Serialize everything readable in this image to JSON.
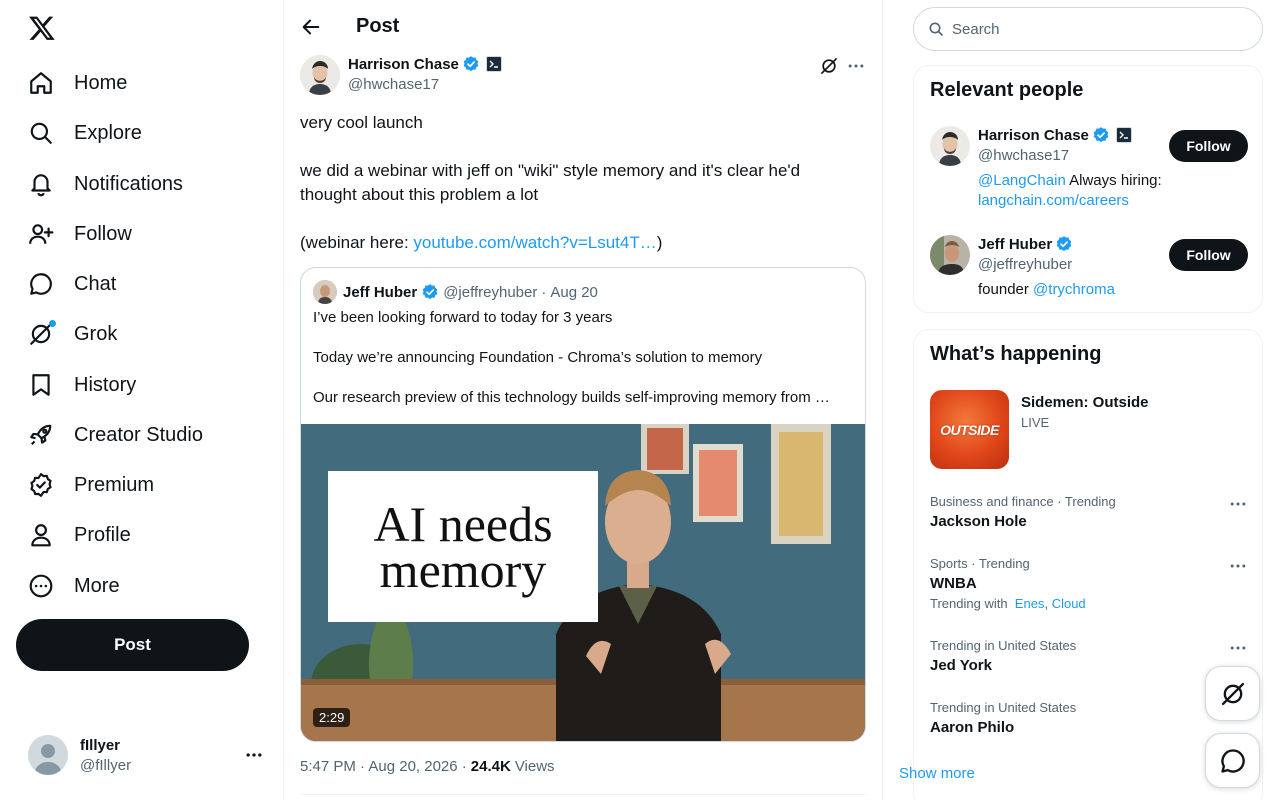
{
  "nav": {
    "items": [
      {
        "label": "Home",
        "icon": "home-icon"
      },
      {
        "label": "Explore",
        "icon": "search-icon"
      },
      {
        "label": "Notifications",
        "icon": "bell-icon"
      },
      {
        "label": "Follow",
        "icon": "person-add-icon"
      },
      {
        "label": "Chat",
        "icon": "chat-bubble-icon"
      },
      {
        "label": "Grok",
        "icon": "grok-icon"
      },
      {
        "label": "History",
        "icon": "bookmark-icon"
      },
      {
        "label": "Creator Studio",
        "icon": "rocket-icon"
      },
      {
        "label": "Premium",
        "icon": "verified-badge-icon"
      },
      {
        "label": "Profile",
        "icon": "person-icon"
      },
      {
        "label": "More",
        "icon": "more-circle-icon"
      }
    ],
    "post_button": "Post"
  },
  "account": {
    "name": "fIllyer",
    "handle": "@fIllyer"
  },
  "header": {
    "title": "Post"
  },
  "post": {
    "author_name": "Harrison Chase",
    "author_handle": "@hwchase17",
    "text_line1": "very cool launch",
    "text_para2": "we did a webinar with jeff on \"wiki\" style memory and it's clear he'd thought about this problem a lot",
    "text_para3_prefix": "(webinar here: ",
    "text_para3_link": "youtube.com/watch?v=Lsut4T…",
    "text_para3_suffix": ")",
    "timestamp": "5:47 PM · Aug 20, 2026 ·",
    "views_count": "24.4K",
    "views_label": "Views"
  },
  "quote": {
    "author_name": "Jeff Huber",
    "author_handle": "@jeffreyhuber",
    "separator": "·",
    "date": "Aug 20",
    "line1": "I’ve been looking forward to today for 3 years",
    "line2": "Today we’re announcing Foundation - Chroma’s solution to memory",
    "line3": "Our research preview of this technology builds self-improving memory from …",
    "media_text_line1": "AI needs",
    "media_text_line2": "memory",
    "duration": "2:29"
  },
  "search": {
    "placeholder": "Search"
  },
  "relevant": {
    "title": "Relevant people",
    "people": [
      {
        "name": "Harrison Chase",
        "handle": "@hwchase17",
        "bio_link1": "@LangChain",
        "bio_text": " Always hiring: ",
        "bio_link2": "langchain.com/careers",
        "follow": "Follow"
      },
      {
        "name": "Jeff Huber",
        "handle": "@jeffreyhuber",
        "bio_text": "founder ",
        "bio_link1": "@trychroma",
        "follow": "Follow"
      }
    ]
  },
  "happening": {
    "title": "What’s happening",
    "event": {
      "title": "Sidemen: Outside",
      "status": "LIVE",
      "image_text": "OUTSIDE"
    },
    "trends": [
      {
        "category": "Business and finance · Trending",
        "name": "Jackson Hole"
      },
      {
        "category": "Sports · Trending",
        "name": "WNBA",
        "with_label": "Trending with",
        "with_1": "Enes",
        "with_sep": ",",
        "with_2": "Cloud"
      },
      {
        "category": "Trending in United States",
        "name": "Jed York"
      },
      {
        "category": "Trending in United States",
        "name": "Aaron Philo"
      }
    ],
    "show_more": "Show more"
  },
  "colors": {
    "accent": "#1d9bf0",
    "text": "#0f1419",
    "muted": "#536471",
    "border": "#eff3f4"
  }
}
